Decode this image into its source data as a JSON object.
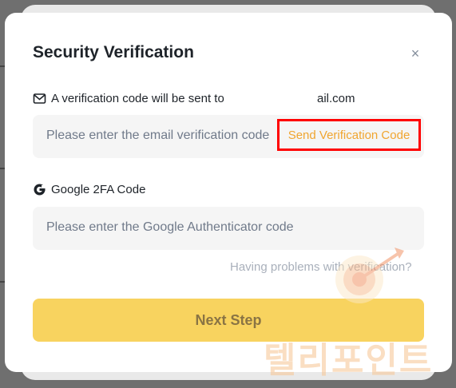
{
  "dialog": {
    "title": "Security Verification",
    "close_glyph": "×",
    "email": {
      "icon": "mail-icon",
      "label": "A verification code will be sent to",
      "address_suffix": "ail.com",
      "placeholder": "Please enter the email verification code",
      "send_button": "Send Verification Code"
    },
    "google": {
      "icon": "google-icon",
      "label": "Google 2FA Code",
      "placeholder": "Please enter the Google Authenticator code"
    },
    "problems_link": "Having problems with verification?",
    "next_button": "Next Step"
  },
  "watermark": {
    "icon": "target-arrow-icon",
    "text": "텔리포인트"
  },
  "colors": {
    "accent": "#f0a530",
    "button_bg": "#f8d35f",
    "highlight_box": "#ff0000",
    "field_bg": "#f5f5f5"
  }
}
